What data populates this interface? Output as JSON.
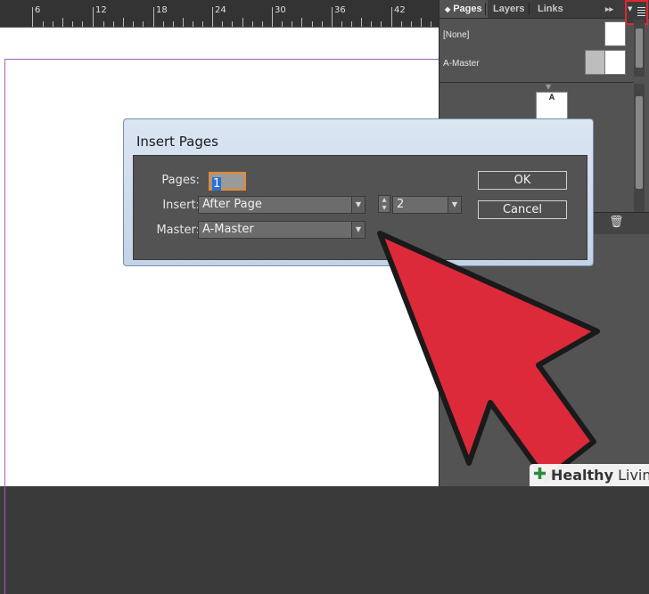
{
  "ruler": {
    "labels": [
      "6",
      "12",
      "18",
      "24",
      "30",
      "36",
      "42"
    ]
  },
  "panel": {
    "tabs": [
      {
        "label": "Pages",
        "active": true
      },
      {
        "label": "Layers",
        "active": false
      },
      {
        "label": "Links",
        "active": false
      }
    ],
    "tab_arrows": "▸▸",
    "masters": [
      {
        "label": "[None]"
      },
      {
        "label": "A-Master"
      }
    ],
    "page_master_letter": "A"
  },
  "dialog": {
    "title": "Insert Pages",
    "pages_label": "Pages:",
    "pages_value": "1",
    "insert_label": "Insert:",
    "insert_value": "After Page",
    "page_number_value": "2",
    "master_label": "Master:",
    "master_value": "A-Master",
    "ok_label": "OK",
    "cancel_label": "Cancel"
  },
  "colors": {
    "highlight_box": "#e0262e",
    "arrow_fill": "#dc2a3a",
    "focus_outline": "#e8892c"
  },
  "watermark": {
    "prefix": "Healthy",
    "suffix": "Living"
  }
}
